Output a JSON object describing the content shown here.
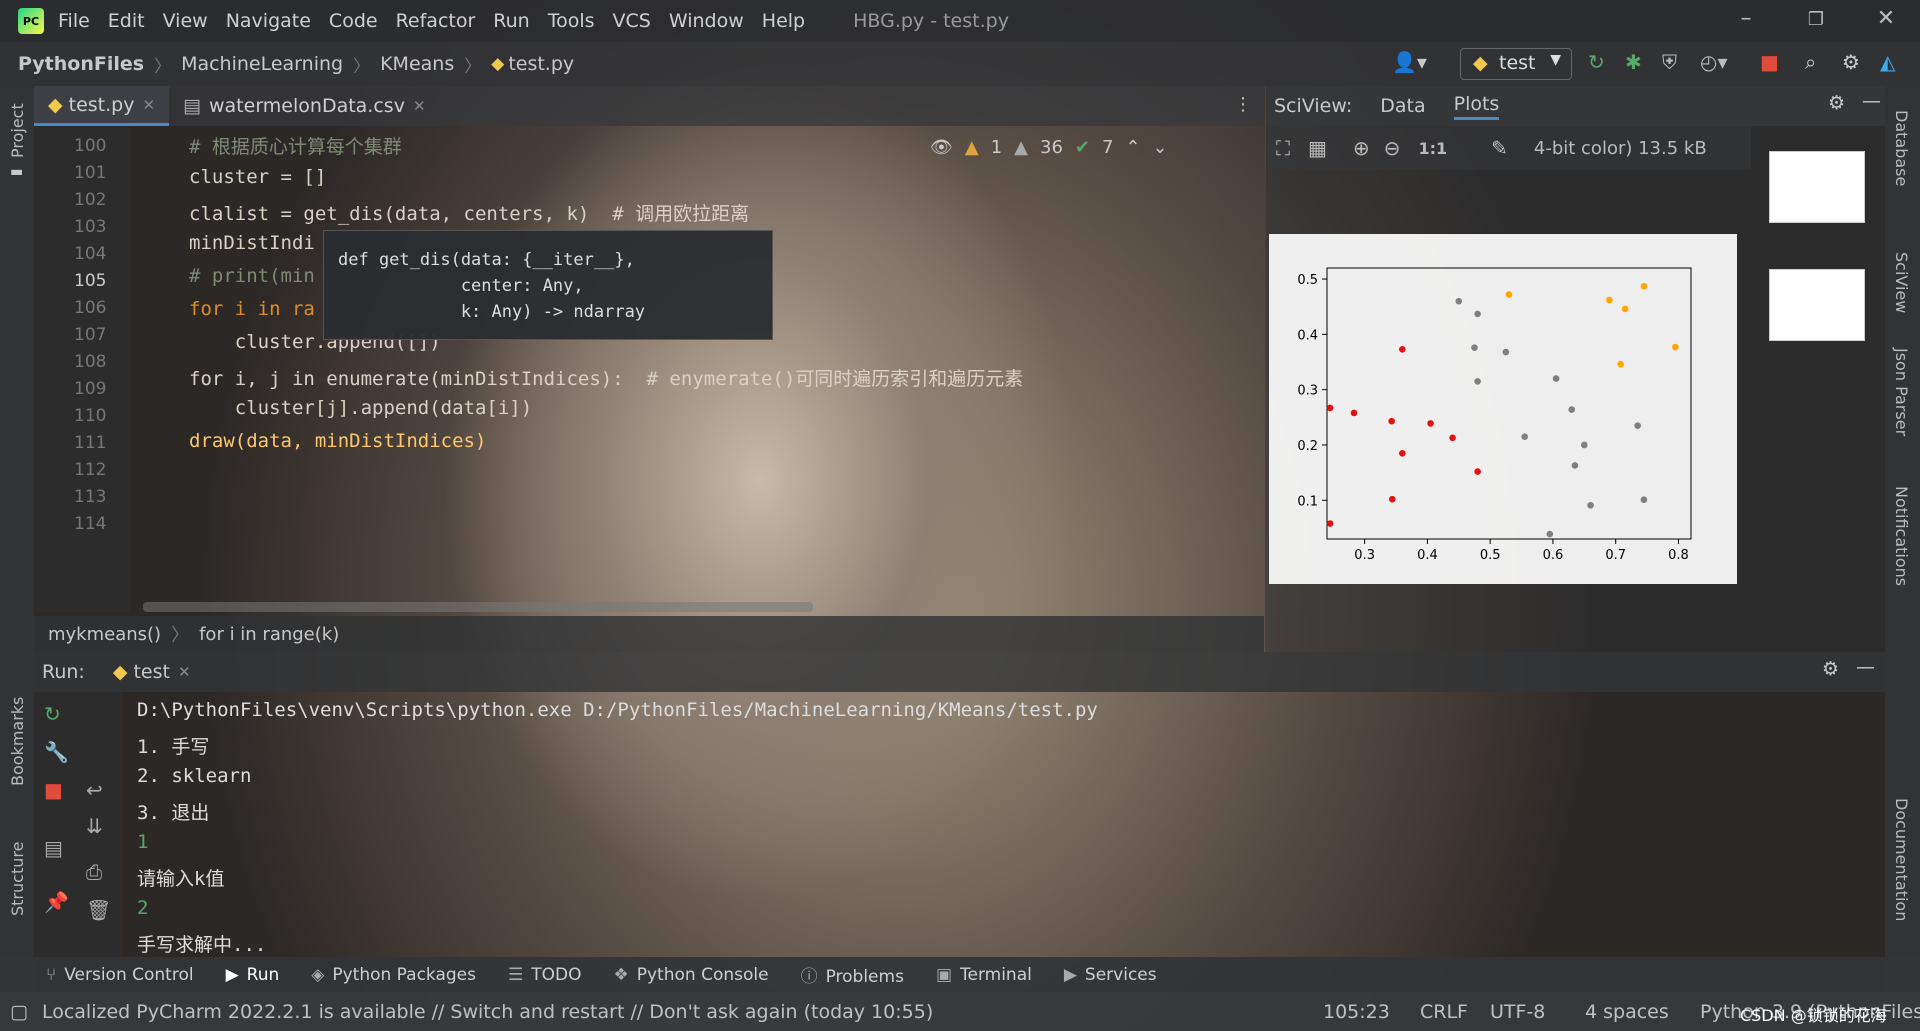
{
  "titlebar": {
    "menus": [
      "File",
      "Edit",
      "View",
      "Navigate",
      "Code",
      "Refactor",
      "Run",
      "Tools",
      "VCS",
      "Window",
      "Help"
    ],
    "title": "HBG.py - test.py"
  },
  "nav": {
    "crumbs": [
      "PythonFiles",
      "MachineLearning",
      "KMeans",
      "test.py"
    ],
    "run_config": "test"
  },
  "editor": {
    "tabs": [
      {
        "label": "test.py",
        "active": true
      },
      {
        "label": "watermelonData.csv",
        "active": false
      }
    ],
    "line_numbers": [
      "100",
      "101",
      "102",
      "103",
      "104",
      "105",
      "106",
      "107",
      "108",
      "109",
      "110",
      "111",
      "112",
      "113",
      "114"
    ],
    "code": [
      {
        "t": "# 根据质心计算每个集群",
        "c": "cm"
      },
      {
        "t": "cluster = []",
        "c": ""
      },
      {
        "t": "clalist = get_dis(data, centers, k)  # 调用欧拉距离",
        "c": ""
      },
      {
        "t": "minDistIndi",
        "c": ""
      },
      {
        "t": "# print(min",
        "c": "cm"
      },
      {
        "t": "for i in ra",
        "c": "kw"
      },
      {
        "t": "    cluster.append([])",
        "c": ""
      },
      {
        "t": "for i, j in enumerate(minDistIndices):  # enymerate()可同时遍历索引和遍历元素",
        "c": ""
      },
      {
        "t": "    cluster[j].append(data[i])",
        "c": ""
      },
      {
        "t": "draw(data, minDistIndices)",
        "c": ""
      }
    ],
    "inspections": {
      "errors": "1",
      "warnings": "36",
      "ok": "7"
    },
    "popup": "def get_dis(data: {__iter__},\n            center: Any,\n            k: Any) -> ndarray",
    "breadcrumb": [
      "mykmeans()",
      "for i in range(k)"
    ]
  },
  "sciview": {
    "title": "SciView:",
    "tabs": [
      "Data",
      "Plots"
    ],
    "active_tab": "Plots",
    "image_info": "4-bit color) 13.5 kB",
    "zoom_label": "1:1"
  },
  "chart_data": {
    "type": "scatter",
    "xlim": [
      0.24,
      0.82
    ],
    "ylim": [
      0.03,
      0.52
    ],
    "xticks": [
      "0.3",
      "0.4",
      "0.5",
      "0.6",
      "0.7",
      "0.8"
    ],
    "yticks": [
      "0.1",
      "0.2",
      "0.3",
      "0.4",
      "0.5"
    ],
    "xtick_values": [
      0.3,
      0.4,
      0.5,
      0.6,
      0.7,
      0.8
    ],
    "ytick_values": [
      0.1,
      0.2,
      0.3,
      0.4,
      0.5
    ],
    "series": [
      {
        "color": "#e8100f",
        "points": [
          [
            0.245,
            0.267
          ],
          [
            0.283,
            0.258
          ],
          [
            0.343,
            0.243
          ],
          [
            0.36,
            0.185
          ],
          [
            0.36,
            0.373
          ],
          [
            0.405,
            0.239
          ],
          [
            0.44,
            0.213
          ],
          [
            0.48,
            0.152
          ],
          [
            0.245,
            0.058
          ],
          [
            0.344,
            0.102
          ]
        ]
      },
      {
        "color": "#7f7f7f",
        "points": [
          [
            0.45,
            0.46
          ],
          [
            0.48,
            0.437
          ],
          [
            0.475,
            0.376
          ],
          [
            0.48,
            0.315
          ],
          [
            0.525,
            0.368
          ],
          [
            0.555,
            0.215
          ],
          [
            0.595,
            0.039
          ],
          [
            0.605,
            0.32
          ],
          [
            0.63,
            0.264
          ],
          [
            0.635,
            0.163
          ],
          [
            0.65,
            0.2
          ],
          [
            0.66,
            0.091
          ],
          [
            0.735,
            0.235
          ],
          [
            0.745,
            0.101
          ]
        ]
      },
      {
        "color": "#ffa500",
        "points": [
          [
            0.53,
            0.472
          ],
          [
            0.69,
            0.462
          ],
          [
            0.715,
            0.446
          ],
          [
            0.745,
            0.487
          ],
          [
            0.708,
            0.346
          ],
          [
            0.795,
            0.377
          ]
        ]
      }
    ]
  },
  "run": {
    "label": "Run:",
    "tab": "test",
    "output": [
      "D:\\PythonFiles\\venv\\Scripts\\python.exe D:/PythonFiles/MachineLearning/KMeans/test.py",
      "1. 手写",
      "2. sklearn",
      "3. 退出",
      "1",
      "请输入k值",
      "2",
      "手写求解中..."
    ]
  },
  "toolwindows": [
    "Version Control",
    "Run",
    "Python Packages",
    "TODO",
    "Python Console",
    "Problems",
    "Terminal",
    "Services"
  ],
  "left_labels": [
    "Project",
    "Bookmarks",
    "Structure"
  ],
  "right_labels": [
    "Database",
    "SciView",
    "Json Parser",
    "Notifications",
    "Documentation"
  ],
  "status": {
    "message": "Localized PyCharm 2022.2.1 is available // Switch and restart // Don't ask again (today 10:55)",
    "position": "105:23",
    "line_sep": "CRLF",
    "encoding": "UTF-8",
    "indent": "4 spaces",
    "interpreter": "Python 3.9 (PythonFiles)",
    "watermark": "CSDN @锁锁的花海"
  }
}
